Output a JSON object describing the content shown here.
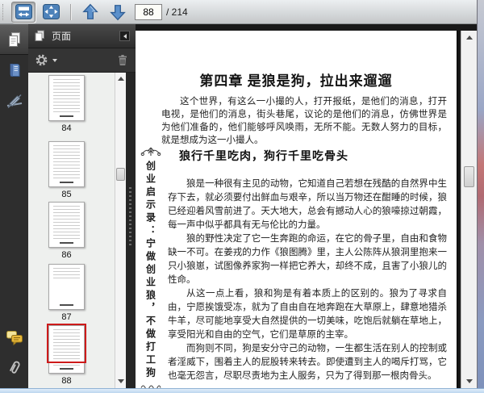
{
  "toolbar": {
    "page_input_value": "88",
    "page_total_label": "/ 214",
    "buttons": [
      {
        "name": "fit-width",
        "pressed": true
      },
      {
        "name": "fit-page",
        "pressed": false
      },
      {
        "name": "page-up",
        "pressed": false
      },
      {
        "name": "page-down",
        "pressed": false
      }
    ]
  },
  "left_rail": {
    "items": [
      {
        "icon": "pages-icon",
        "active": true
      },
      {
        "icon": "bookmarks-icon",
        "active": false
      },
      {
        "icon": "signature-icon",
        "active": false
      },
      {
        "icon": "comments-icon",
        "active": false
      },
      {
        "icon": "attachment-icon",
        "active": false
      }
    ]
  },
  "thumbnail_panel": {
    "title": "页面",
    "tools": [
      "gear-icon",
      "trash-icon"
    ],
    "thumbnails": [
      {
        "page_label": "84",
        "current": false
      },
      {
        "page_label": "85",
        "current": false
      },
      {
        "page_label": "86",
        "current": false
      },
      {
        "page_label": "87",
        "current": false
      },
      {
        "page_label": "88",
        "current": true
      }
    ]
  },
  "document_page": {
    "chapter_title": "第四章 是狼是狗，拉出来遛遛",
    "intro_paragraph": "这个世界，有这么一小撮的人，打开报纸，是他们的消息，打开电视，是他们的消息，街头巷尾，议论的是他们的消息，仿佛世界是为他们准备的，他们能够呼风唤雨，无所不能。无数人努力的目标，就是想成为这一小撮人。",
    "section_heading": "狼行千里吃肉，狗行千里吃骨头",
    "margin_caption": "创业启示录：宁做创业狼，不做打工狗",
    "body_paragraphs": [
      "狼是一种很有主见的动物，它知道自己若想在残酷的自然界中生存下去，就必须要付出鲜血与艰辛，所以当万物还在酣睡的时候，狼已经迎着风雪前进了。天大地大，总会有撼动人心的狼嚎掠过朝霞，每一声中似乎都具有无与伦比的力量。",
      "狼的野性决定了它一生奔跑的命运，在它的骨子里，自由和食物缺一不可。在姜戎的力作《狼图腾》里，主人公陈阵从狼洞里抱来一只小狼崽，试图像养家狗一样把它养大，却终不成，且害了小狼儿的性命。",
      "从这一点上看，狼和狗是有着本质上的区别的。狼为了寻求自由，宁愿挨饿受冻，就为了自由自在地奔跑在大草原上，肆意地猎杀牛羊，尽可能地享受大自然提供的一切美味，吃饱后就躺在草地上，享受阳光和自由的空气，它们是草原的主宰。",
      "而狗则不同，狗是安分守己的动物，一生都生活在别人的控制或者淫威下，围着主人的屁股转来转去。即使遭到主人的喝斥打骂，它也毫无怨言，尽职尽责地为主人服务，只为了得到那一根肉骨头。"
    ]
  },
  "colors": {
    "selection_red": "#cd1a1a",
    "toolbar_icon_blue": "#4d82ba",
    "comments_yellow": "#e9b93b",
    "window_border_blue": "#bcd6ef"
  }
}
